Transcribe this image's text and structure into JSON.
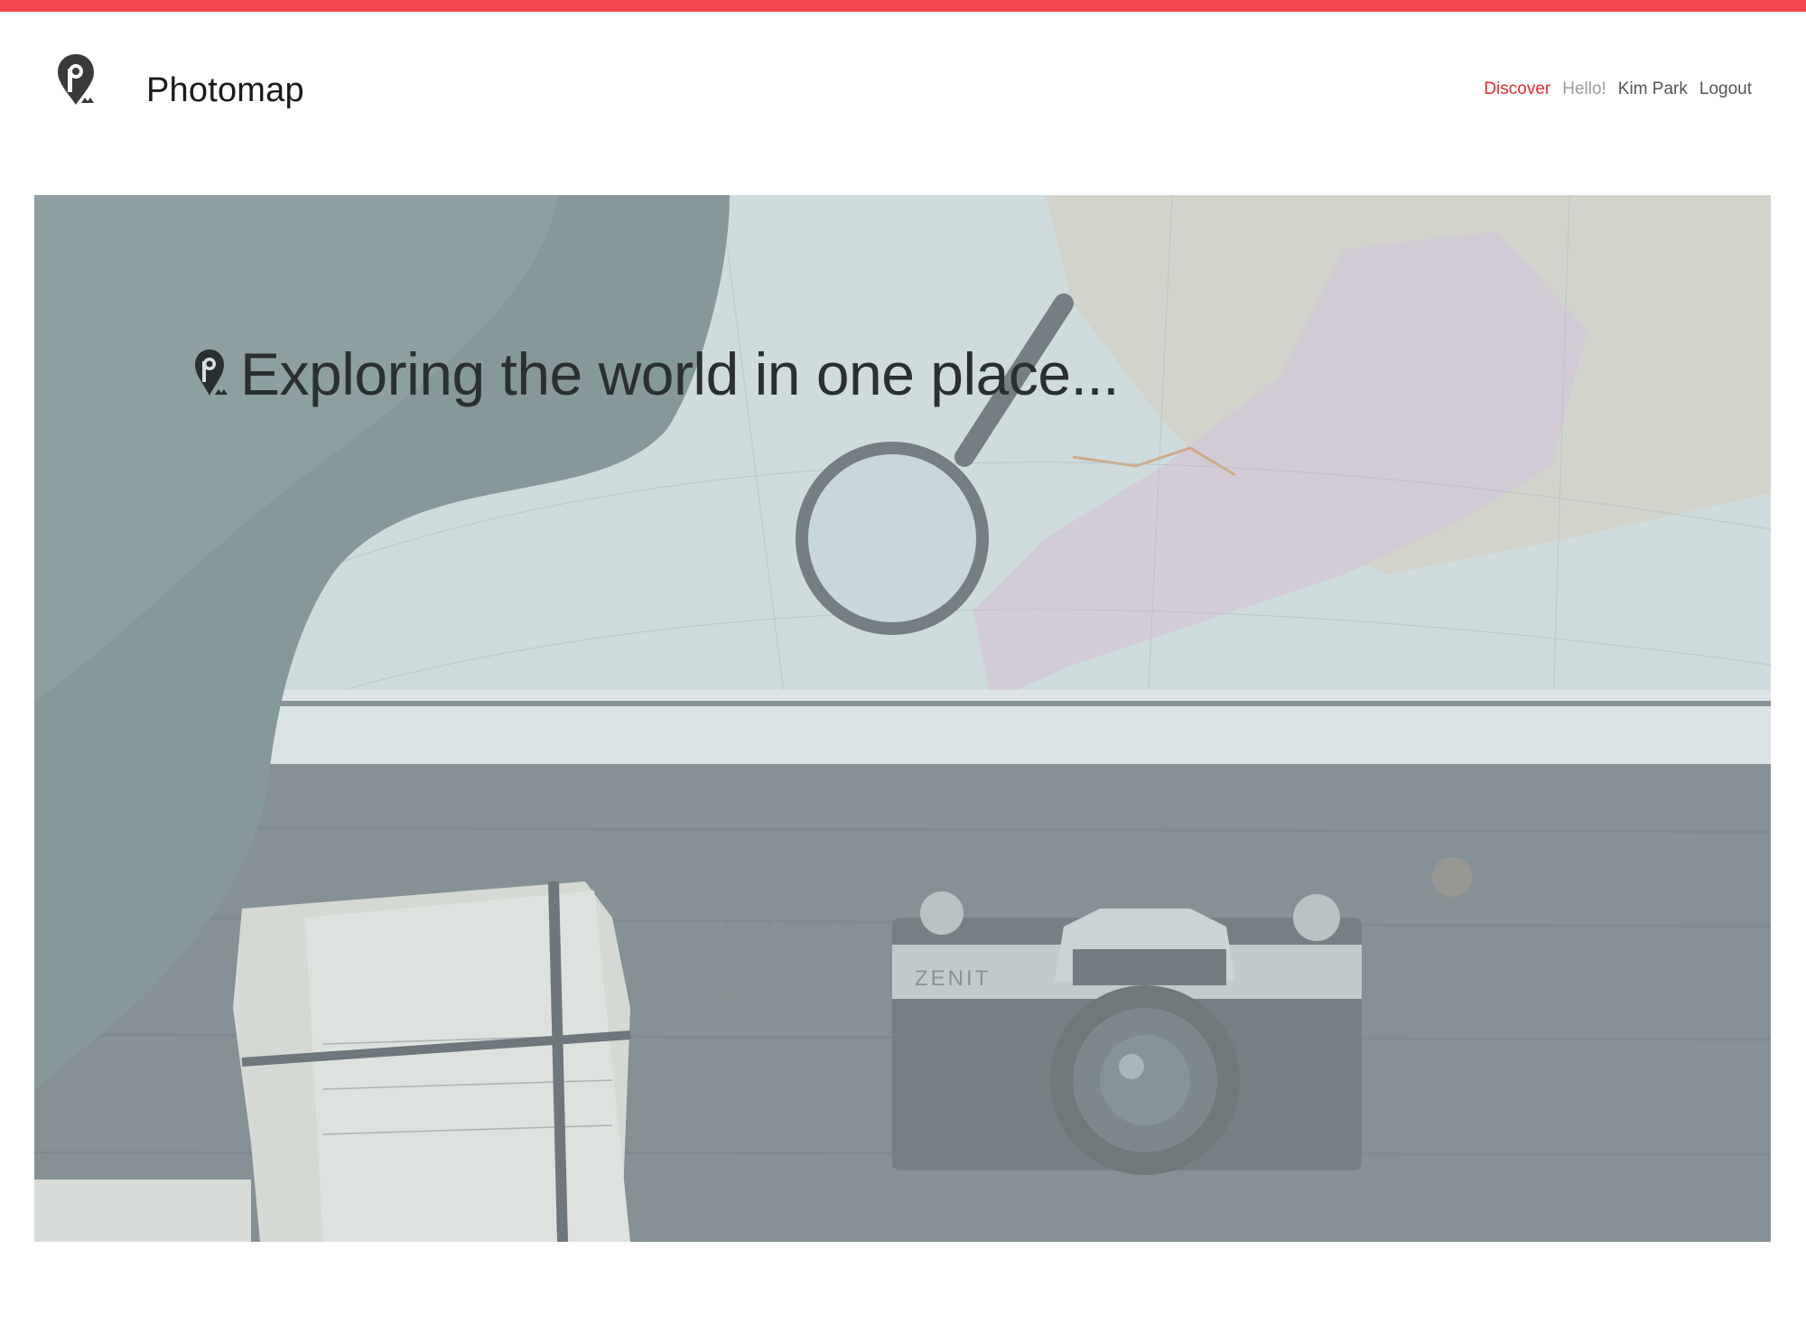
{
  "brand": {
    "name": "Photomap",
    "icon": "map-pin-p-logo-icon"
  },
  "nav": {
    "discover": "Discover",
    "hello": "Hello!",
    "user": "Kim Park",
    "logout": "Logout"
  },
  "hero": {
    "tagline": "Exploring the world in one place...",
    "tagline_icon": "map-pin-p-logo-icon",
    "image_description": "flat-lay of map with magnifying glass, bundle of old letters and Zenit camera on dark wood"
  },
  "colors": {
    "accent_bar": "#f2474d",
    "discover_link": "#e52a2f",
    "hello_text": "#9b9b9b",
    "nav_text": "#555555",
    "brand_text": "#1b1b1b"
  }
}
